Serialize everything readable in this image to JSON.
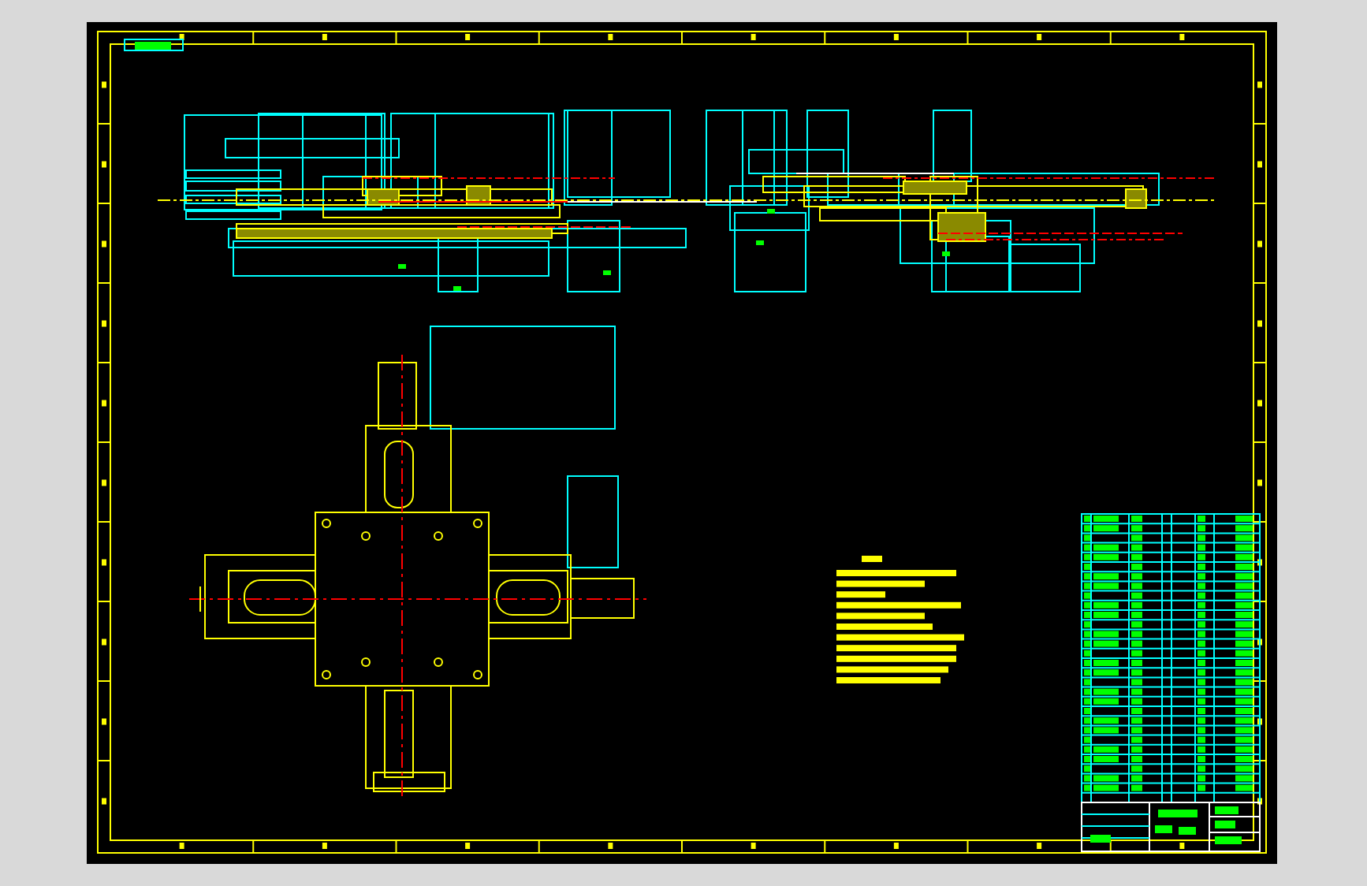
{
  "sheet": {
    "kind": "cad-drawing"
  }
}
